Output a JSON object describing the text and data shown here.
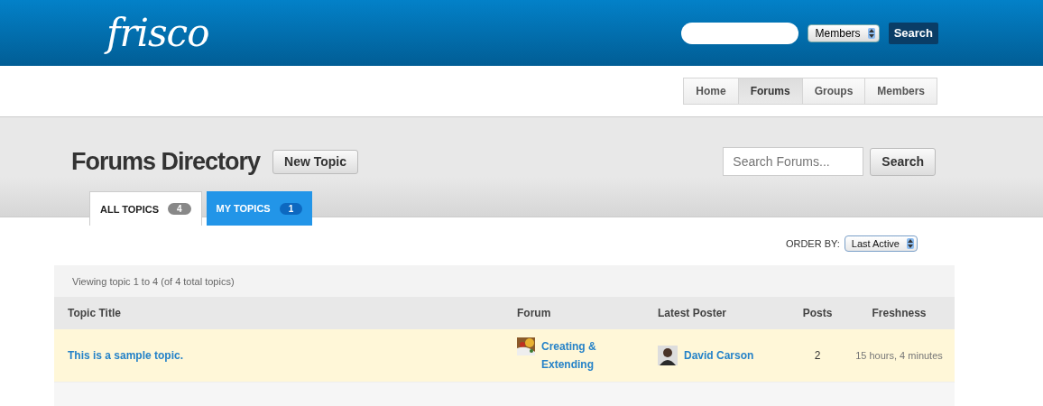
{
  "header": {
    "logo": "frisco",
    "scope": "Members",
    "search_button": "Search"
  },
  "nav": [
    {
      "label": "Home",
      "selected": false
    },
    {
      "label": "Forums",
      "selected": true
    },
    {
      "label": "Groups",
      "selected": false
    },
    {
      "label": "Members",
      "selected": false
    }
  ],
  "page": {
    "title": "Forums Directory",
    "new_topic": "New Topic",
    "search_placeholder": "Search Forums...",
    "search_button": "Search"
  },
  "tabs": [
    {
      "label": "ALL TOPICS",
      "count": "4",
      "selected": true
    },
    {
      "label": "MY TOPICS",
      "count": "1",
      "selected": false
    }
  ],
  "order": {
    "label": "ORDER BY:",
    "value": "Last Active"
  },
  "table": {
    "info": "Viewing topic 1 to 4 (of 4 total topics)",
    "columns": [
      "Topic Title",
      "Forum",
      "Latest Poster",
      "Posts",
      "Freshness"
    ],
    "rows": [
      {
        "title": "This is a sample topic.",
        "forum": "Creating & Extending",
        "poster": "David Carson",
        "posts": "2",
        "freshness": "15 hours, 4 minutes",
        "highlighted": true
      }
    ]
  }
}
